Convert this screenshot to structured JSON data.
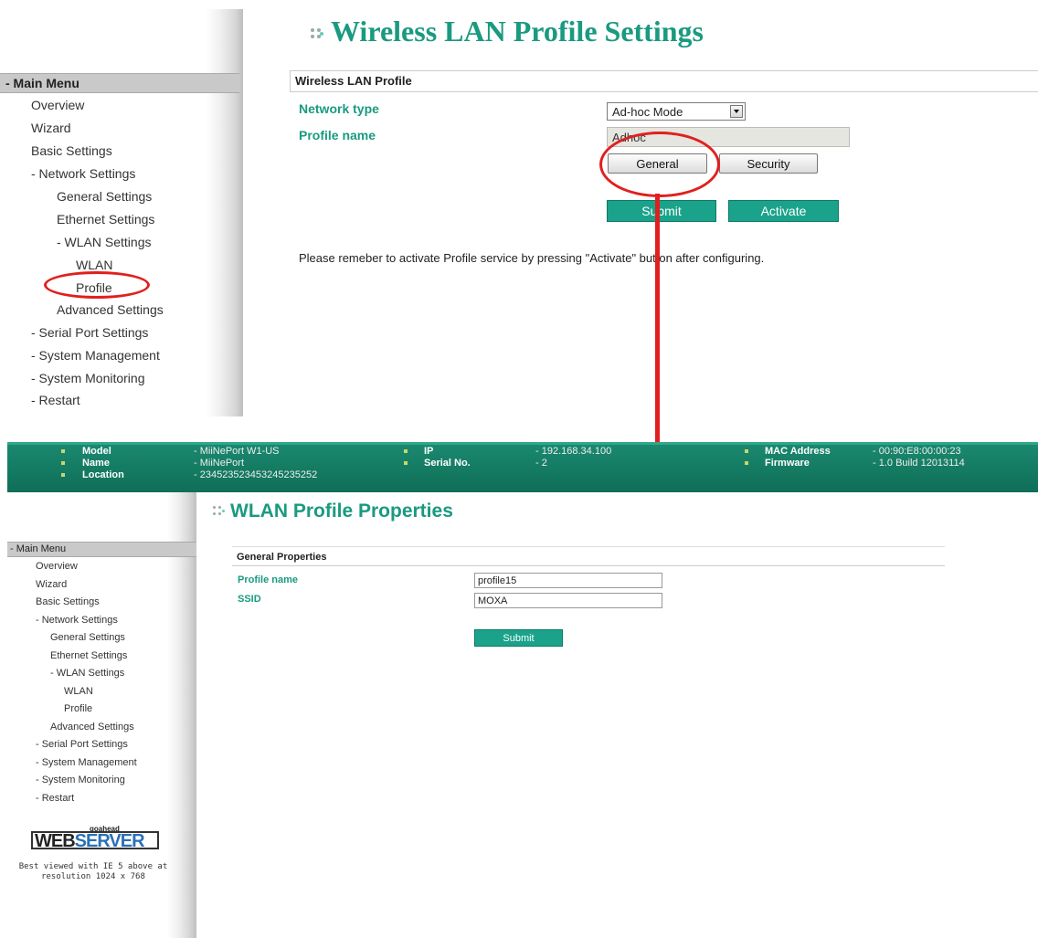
{
  "top": {
    "title": "Wireless LAN Profile Settings",
    "menu_header": "- Main Menu",
    "menu_items": [
      {
        "label": "Overview"
      },
      {
        "label": "Wizard"
      },
      {
        "label": "Basic Settings"
      },
      {
        "label": "- Network Settings"
      },
      {
        "label": "General Settings"
      },
      {
        "label": "Ethernet Settings"
      },
      {
        "label": "- WLAN Settings"
      },
      {
        "label": "WLAN"
      },
      {
        "label": "Profile"
      },
      {
        "label": "Advanced Settings"
      },
      {
        "label": "- Serial Port Settings"
      },
      {
        "label": "- System Management"
      },
      {
        "label": "- System Monitoring"
      },
      {
        "label": "- Restart"
      }
    ],
    "section_title": "Wireless LAN Profile",
    "network_type_label": "Network type",
    "network_type_value": "Ad-hoc Mode",
    "profile_name_label": "Profile name",
    "profile_name_value": "Adhoc",
    "general_button": "General",
    "security_button": "Security",
    "submit_button": "Submit",
    "activate_button": "Activate",
    "note": "Please remeber to activate Profile service by pressing \"Activate\" button after configuring."
  },
  "status": {
    "model_label": "Model",
    "model_value": "- MiiNePort W1-US",
    "name_label": "Name",
    "name_value": "- MiiNePort",
    "location_label": "Location",
    "location_value": "- 234523523453245235252",
    "ip_label": "IP",
    "ip_value": "- 192.168.34.100",
    "serial_label": "Serial No.",
    "serial_value": "- 2",
    "mac_label": "MAC Address",
    "mac_value": "- 00:90:E8:00:00:23",
    "firmware_label": "Firmware",
    "firmware_value": "- 1.0 Build 12013114"
  },
  "bottom": {
    "title": "WLAN Profile Properties",
    "menu_header": "- Main Menu",
    "menu_items": [
      {
        "label": "Overview"
      },
      {
        "label": "Wizard"
      },
      {
        "label": "Basic Settings"
      },
      {
        "label": "- Network Settings"
      },
      {
        "label": "General Settings"
      },
      {
        "label": "Ethernet Settings"
      },
      {
        "label": "- WLAN Settings"
      },
      {
        "label": "WLAN"
      },
      {
        "label": "Profile"
      },
      {
        "label": "Advanced Settings"
      },
      {
        "label": "- Serial Port Settings"
      },
      {
        "label": "- System Management"
      },
      {
        "label": "- System Monitoring"
      },
      {
        "label": "- Restart"
      }
    ],
    "section_title": "General Properties",
    "profile_name_label": "Profile name",
    "profile_name_value": "profile15",
    "ssid_label": "SSID",
    "ssid_value": "MOXA",
    "submit_button": "Submit",
    "logo_top": "goahead",
    "logo_web": "WEB",
    "logo_server": "SERVER",
    "logo_note_line1": "Best viewed with IE 5 above at",
    "logo_note_line2": "resolution 1024 x 768"
  },
  "colors": {
    "accent": "#1a9a80",
    "status_bar": "#0f6e58",
    "highlight": "#e0201e"
  },
  "icons": [
    "dots-bullet-icon",
    "dropdown-arrow-icon",
    "red-arrow-icon",
    "webserver-logo"
  ]
}
